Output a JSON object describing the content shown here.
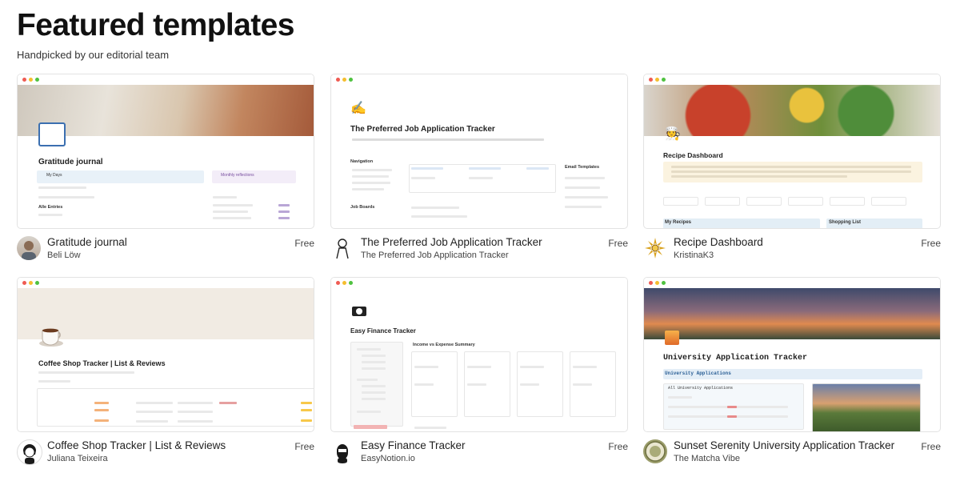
{
  "header": {
    "title": "Featured templates",
    "subtitle": "Handpicked by our editorial team"
  },
  "templates": [
    {
      "title": "Gratitude journal",
      "author": "Beli Löw",
      "price": "Free",
      "preview_title": "Gratitude journal",
      "preview_labels": [
        "My Days",
        "Monthly reflections",
        "Alle Entries"
      ],
      "avatar_icon": "person-photo-icon"
    },
    {
      "title": "The Preferred Job Application Tracker",
      "author": "The Preferred Job Application Tracker",
      "price": "Free",
      "preview_title": "The Preferred Job Application Tracker",
      "preview_labels": [
        "Navigation",
        "Email Templates",
        "Job Boards"
      ],
      "avatar_icon": "person-sketch-icon"
    },
    {
      "title": "Recipe Dashboard",
      "author": "KristinaK3",
      "price": "Free",
      "preview_title": "Recipe Dashboard",
      "preview_labels": [
        "My Recipes",
        "Shopping List"
      ],
      "avatar_icon": "sun-flower-icon"
    },
    {
      "title": "Coffee Shop Tracker | List & Reviews",
      "author": "Juliana Teixeira",
      "price": "Free",
      "preview_title": "Coffee Shop Tracker | List & Reviews",
      "preview_labels": [],
      "avatar_icon": "person-cartoon-icon"
    },
    {
      "title": "Easy Finance Tracker",
      "author": "EasyNotion.io",
      "price": "Free",
      "preview_title": "Easy Finance Tracker",
      "preview_labels": [
        "Income vs Expense Summary"
      ],
      "avatar_icon": "person-silhouette-icon"
    },
    {
      "title": "Sunset Serenity University Application Tracker",
      "author": "The Matcha Vibe",
      "price": "Free",
      "preview_title": "University Application Tracker",
      "preview_labels": [
        "University Applications",
        "All University Applications"
      ],
      "avatar_icon": "badge-logo-icon"
    }
  ]
}
